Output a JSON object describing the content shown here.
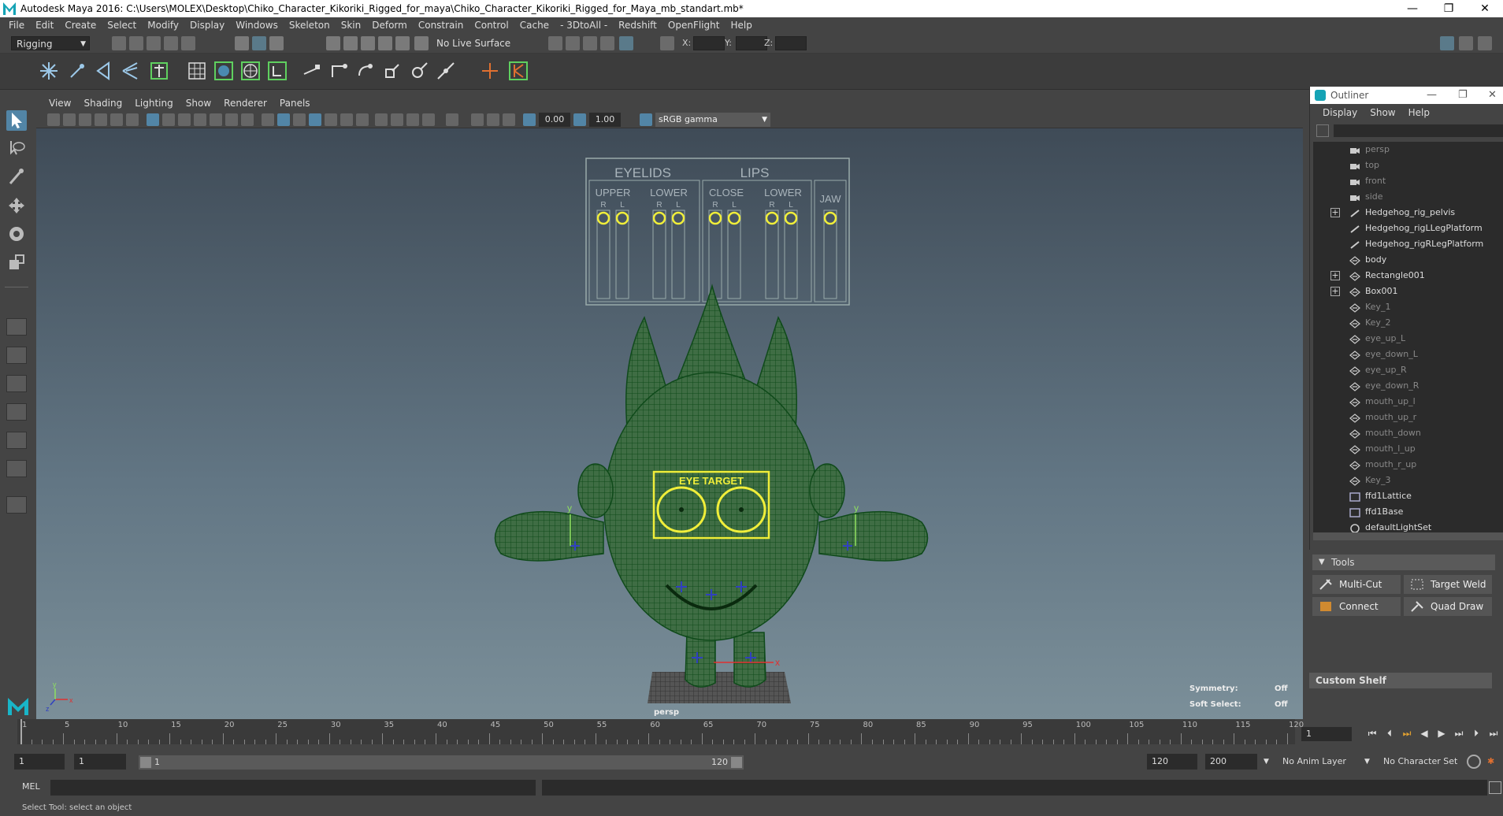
{
  "window": {
    "title": "Autodesk Maya 2016: C:\\Users\\MOLEX\\Desktop\\Chiko_Character_Kikoriki_Rigged_for_maya\\Chiko_Character_Kikoriki_Rigged_for_Maya_mb_standart.mb*",
    "minimize": "—",
    "restore": "❐",
    "close": "✕"
  },
  "menubar": [
    "File",
    "Edit",
    "Create",
    "Select",
    "Modify",
    "Display",
    "Windows",
    "Skeleton",
    "Skin",
    "Deform",
    "Constrain",
    "Control",
    "Cache",
    "- 3DtoAll -",
    "Redshift",
    "OpenFlight",
    "Help"
  ],
  "toolbar": {
    "mode": "Rigging",
    "live_surface": "No Live Surface",
    "x_label": "X:",
    "y_label": "Y:",
    "z_label": "Z:"
  },
  "viewport": {
    "menu": [
      "View",
      "Shading",
      "Lighting",
      "Show",
      "Renderer",
      "Panels"
    ],
    "exposure": "0.00",
    "gamma": "1.00",
    "color_space": "sRGB gamma",
    "camera_label": "persp",
    "symmetry_label": "Symmetry:",
    "symmetry_value": "Off",
    "soft_select_label": "Soft Select:",
    "soft_select_value": "Off",
    "rig_panel": {
      "eyelids": "EYELIDS",
      "lips": "LIPS",
      "upper": "UPPER",
      "lower": "LOWER",
      "close": "CLOSE",
      "lower2": "LOWER",
      "jaw": "JAW",
      "r": "R",
      "l": "L"
    },
    "eye_target": "EYE TARGET",
    "axis_y": "y",
    "axis_x": "x",
    "axis_z": "z"
  },
  "outliner": {
    "title": "Outliner",
    "menu": [
      "Display",
      "Show",
      "Help"
    ],
    "items": [
      {
        "label": "persp",
        "dim": true,
        "icon": "camera-icon",
        "expand": false
      },
      {
        "label": "top",
        "dim": true,
        "icon": "camera-icon",
        "expand": false
      },
      {
        "label": "front",
        "dim": true,
        "icon": "camera-icon",
        "expand": false
      },
      {
        "label": "side",
        "dim": true,
        "icon": "camera-icon",
        "expand": false
      },
      {
        "label": "Hedgehog_rig_pelvis",
        "dim": false,
        "icon": "joint-icon",
        "expand": true
      },
      {
        "label": "Hedgehog_rigLLegPlatform",
        "dim": false,
        "icon": "joint-icon",
        "expand": false
      },
      {
        "label": "Hedgehog_rigRLegPlatform",
        "dim": false,
        "icon": "joint-icon",
        "expand": false
      },
      {
        "label": "body",
        "dim": false,
        "icon": "transform-icon",
        "expand": false
      },
      {
        "label": "Rectangle001",
        "dim": false,
        "icon": "transform-icon",
        "expand": true
      },
      {
        "label": "Box001",
        "dim": false,
        "icon": "transform-icon",
        "expand": true
      },
      {
        "label": "Key_1",
        "dim": true,
        "icon": "transform-icon",
        "expand": false
      },
      {
        "label": "Key_2",
        "dim": true,
        "icon": "transform-icon",
        "expand": false
      },
      {
        "label": "eye_up_L",
        "dim": true,
        "icon": "transform-icon",
        "expand": false
      },
      {
        "label": "eye_down_L",
        "dim": true,
        "icon": "transform-icon",
        "expand": false
      },
      {
        "label": "eye_up_R",
        "dim": true,
        "icon": "transform-icon",
        "expand": false
      },
      {
        "label": "eye_down_R",
        "dim": true,
        "icon": "transform-icon",
        "expand": false
      },
      {
        "label": "mouth_up_l",
        "dim": true,
        "icon": "transform-icon",
        "expand": false
      },
      {
        "label": "mouth_up_r",
        "dim": true,
        "icon": "transform-icon",
        "expand": false
      },
      {
        "label": "mouth_down",
        "dim": true,
        "icon": "transform-icon",
        "expand": false
      },
      {
        "label": "mouth_l_up",
        "dim": true,
        "icon": "transform-icon",
        "expand": false
      },
      {
        "label": "mouth_r_up",
        "dim": true,
        "icon": "transform-icon",
        "expand": false
      },
      {
        "label": "Key_3",
        "dim": true,
        "icon": "transform-icon",
        "expand": false
      },
      {
        "label": "ffd1Lattice",
        "dim": false,
        "icon": "lattice-icon",
        "expand": false
      },
      {
        "label": "ffd1Base",
        "dim": false,
        "icon": "lattice-icon",
        "expand": false
      },
      {
        "label": "defaultLightSet",
        "dim": false,
        "icon": "set-icon",
        "expand": false
      }
    ]
  },
  "tools": {
    "header": "Tools",
    "multi_cut": "Multi-Cut",
    "target_weld": "Target Weld",
    "connect": "Connect",
    "quad_draw": "Quad Draw"
  },
  "custom_shelf": "Custom Shelf",
  "timeline": {
    "ticks": [
      "1",
      "5",
      "10",
      "15",
      "20",
      "25",
      "30",
      "35",
      "40",
      "45",
      "50",
      "55",
      "60",
      "65",
      "70",
      "75",
      "80",
      "85",
      "90",
      "95",
      "100",
      "105",
      "110",
      "115",
      "120"
    ],
    "current_frame": "1"
  },
  "range": {
    "start": "1",
    "playback_start": "1",
    "range_start_label": "1",
    "range_end_label": "120",
    "playback_end": "120",
    "end": "200",
    "anim_layer": "No Anim Layer",
    "character_set": "No Character Set"
  },
  "command": {
    "label": "MEL"
  },
  "status": "Select Tool: select an object",
  "colors": {
    "wire": "#1e6b2a",
    "control": "#e8e34a",
    "accent": "#5285a6"
  }
}
